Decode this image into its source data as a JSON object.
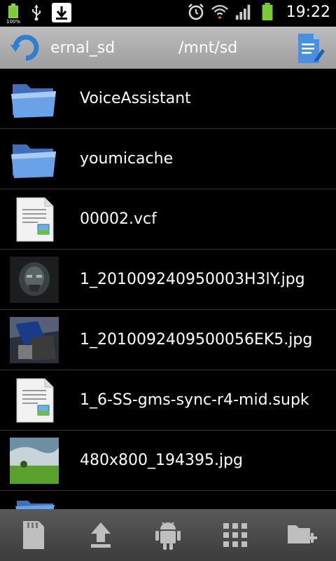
{
  "status_bar": {
    "battery_small_label": "100%",
    "time": "19:22",
    "icons": [
      "battery-icon",
      "usb-icon",
      "download-icon",
      "alarm-icon",
      "wifi-icon",
      "signal-icon",
      "battery-full-icon"
    ]
  },
  "title_bar": {
    "left_text": "ernal_sd",
    "center_text": "/mnt/sd"
  },
  "files": [
    {
      "name": "VoiceAssistant",
      "type": "folder"
    },
    {
      "name": "youmicache",
      "type": "folder"
    },
    {
      "name": "00002.vcf",
      "type": "document"
    },
    {
      "name": "1_201009240950003H3lY.jpg",
      "type": "image-robot-dark"
    },
    {
      "name": "1_2010092409500056EK5.jpg",
      "type": "image-robot-blue"
    },
    {
      "name": "1_6-SS-gms-sync-r4-mid.supk",
      "type": "document"
    },
    {
      "name": "480x800_194395.jpg",
      "type": "image-landscape"
    }
  ],
  "bottom_bar": [
    "sdcard-icon",
    "upload-icon",
    "android-icon",
    "apps-grid-icon",
    "new-folder-icon"
  ],
  "colors": {
    "folder": "#5a8fd8",
    "titlebar": "#ababab",
    "bottombar": "#4a4a4a",
    "battery_green": "#7acb3a"
  }
}
